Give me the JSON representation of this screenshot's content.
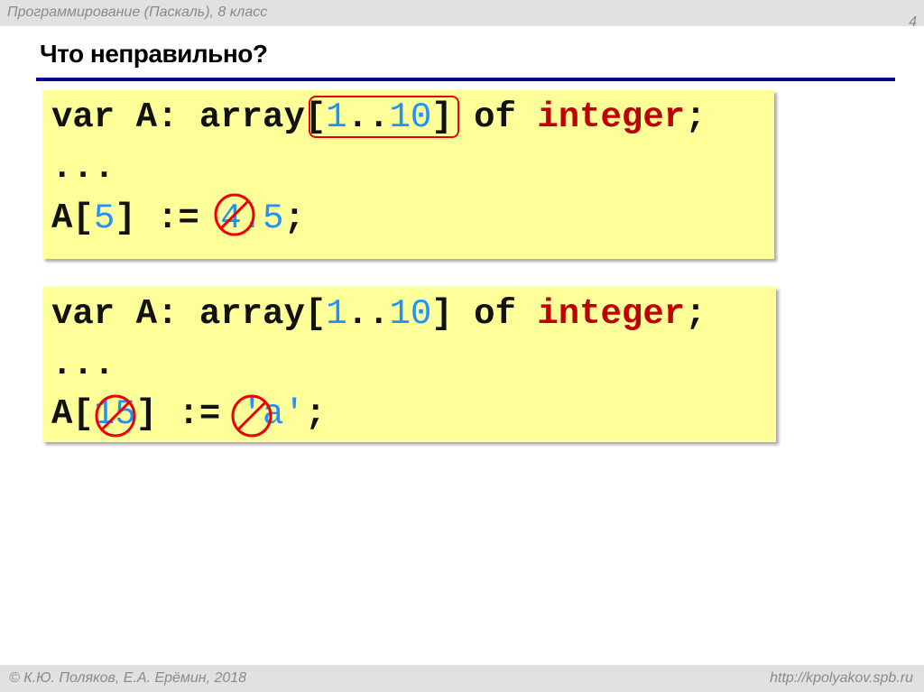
{
  "header": {
    "course": "Программирование (Паскаль), 8 класс",
    "page_number": "4"
  },
  "title": "Что неправильно?",
  "block1": {
    "l1": {
      "a": "var A: array[",
      "n1": "1",
      "b": "..",
      "n2": "10",
      "c": "] of ",
      "kw": "integer",
      "d": ";"
    },
    "l2": "...",
    "l3": {
      "a": "A[",
      "n1": "5",
      "b": "] := ",
      "n2": "4.5",
      "c": ";"
    }
  },
  "block2": {
    "l1": {
      "a": "var A: array[",
      "n1": "1",
      "b": "..",
      "n2": "10",
      "c": "] of ",
      "kw": "integer",
      "d": ";"
    },
    "l2": "...",
    "l3": {
      "a": "A[",
      "n1": "15",
      "b": "] := ",
      "n2": "'a'",
      "c": ";"
    }
  },
  "footer": {
    "authors": "© К.Ю. Поляков, Е.А. Ерёмин, 2018",
    "url": "http://kpolyakov.spb.ru"
  },
  "colors": {
    "accent": "#00008b",
    "code_bg": "#ffff99",
    "keyword": "#c00000",
    "number": "#1e90ff",
    "mark": "#e00000"
  }
}
